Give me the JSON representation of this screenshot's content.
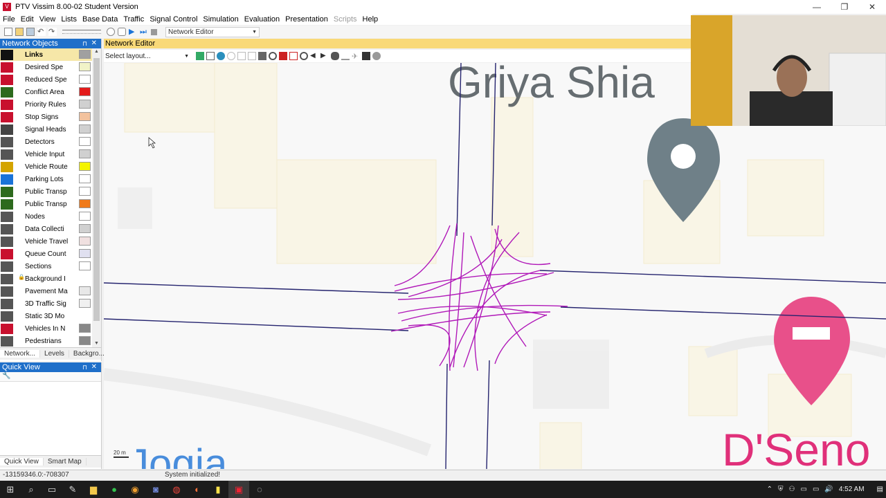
{
  "window": {
    "title": "PTV Vissim 8.00-02 Student Version",
    "app_icon": "vissim-icon"
  },
  "menu": [
    "File",
    "Edit",
    "View",
    "Lists",
    "Base Data",
    "Traffic",
    "Signal Control",
    "Simulation",
    "Evaluation",
    "Presentation",
    "Scripts",
    "Help"
  ],
  "toolbar": {
    "view_select": "Network Editor"
  },
  "network_objects": {
    "title": "Network Objects",
    "items": [
      {
        "label": "Links",
        "icon": "links-icon",
        "icon_color": "#111111",
        "swatch": "#a0a0a0",
        "selected": true
      },
      {
        "label": "Desired Spe",
        "icon": "desired-speed-icon",
        "icon_color": "#c8102e",
        "swatch": "#f1f3c8"
      },
      {
        "label": "Reduced Spe",
        "icon": "reduced-speed-icon",
        "icon_color": "#c8102e",
        "swatch": "#ffffff"
      },
      {
        "label": "Conflict Area",
        "icon": "conflict-area-icon",
        "icon_color": "#2d6a1d",
        "swatch": "#e31b1b"
      },
      {
        "label": "Priority Rules",
        "icon": "priority-rules-icon",
        "icon_color": "#c8102e",
        "swatch": "#d0d0d0"
      },
      {
        "label": "Stop Signs",
        "icon": "stop-sign-icon",
        "icon_color": "#c8102e",
        "swatch": "#f3c29d"
      },
      {
        "label": "Signal Heads",
        "icon": "signal-head-icon",
        "icon_color": "#444444",
        "swatch": "#d0d0d0"
      },
      {
        "label": "Detectors",
        "icon": "detector-icon",
        "icon_color": "#555555",
        "swatch": "#ffffff"
      },
      {
        "label": "Vehicle Input",
        "icon": "vehicle-input-icon",
        "icon_color": "#555555",
        "swatch": "#d0d0d0"
      },
      {
        "label": "Vehicle Route",
        "icon": "vehicle-route-icon",
        "icon_color": "#d4a400",
        "swatch": "#f4f400"
      },
      {
        "label": "Parking Lots",
        "icon": "parking-lot-icon",
        "icon_color": "#1a73d8",
        "swatch": "#ffffff"
      },
      {
        "label": "Public Transp",
        "icon": "pt-stop-icon",
        "icon_color": "#2d6a1d",
        "swatch": "#ffffff"
      },
      {
        "label": "Public Transp",
        "icon": "pt-line-icon",
        "icon_color": "#2d6a1d",
        "swatch": "#f07a1a"
      },
      {
        "label": "Nodes",
        "icon": "nodes-icon",
        "icon_color": "#555555",
        "swatch": "#ffffff"
      },
      {
        "label": "Data Collecti",
        "icon": "data-collection-icon",
        "icon_color": "#555555",
        "swatch": "#d0d0d0"
      },
      {
        "label": "Vehicle Travel",
        "icon": "vehicle-travel-icon",
        "icon_color": "#555555",
        "swatch": "#f0e0e0"
      },
      {
        "label": "Queue Count",
        "icon": "queue-counter-icon",
        "icon_color": "#c8102e",
        "swatch": "#e0e0f0"
      },
      {
        "label": "Sections",
        "icon": "sections-icon",
        "icon_color": "#555555",
        "swatch": "#ffffff"
      },
      {
        "label": "Background I",
        "icon": "background-image-icon",
        "icon_color": "#555555",
        "swatch": "",
        "locked": true
      },
      {
        "label": "Pavement Ma",
        "icon": "pavement-marking-icon",
        "icon_color": "#555555",
        "swatch": "#e8e8e8"
      },
      {
        "label": "3D Traffic Sig",
        "icon": "traffic-sign-3d-icon",
        "icon_color": "#555555",
        "swatch": "#f0f0f0"
      },
      {
        "label": "Static 3D Mo",
        "icon": "static-3d-model-icon",
        "icon_color": "#555555",
        "swatch": ""
      },
      {
        "label": "Vehicles In N",
        "icon": "vehicles-in-network-icon",
        "icon_color": "#c8102e",
        "swatch": "#888888"
      },
      {
        "label": "Pedestrians",
        "icon": "pedestrians-icon",
        "icon_color": "#555555",
        "swatch": "#888888"
      }
    ],
    "tabs": [
      "Network...",
      "Levels",
      "Backgro..."
    ]
  },
  "quick_view": {
    "title": "Quick View",
    "tabs": [
      "Quick View",
      "Smart Map"
    ]
  },
  "network_editor": {
    "title": "Network Editor",
    "layout_placeholder": "Select layout...",
    "map_labels": {
      "top": "Griya Shia",
      "bottom_left": "Jogja",
      "bottom_right": "D'Seno",
      "scale": "20 m"
    }
  },
  "status": {
    "coords": "-13159346.0:-708307",
    "message": "System initialized!"
  },
  "taskbar": {
    "clock": "4:52 AM"
  }
}
